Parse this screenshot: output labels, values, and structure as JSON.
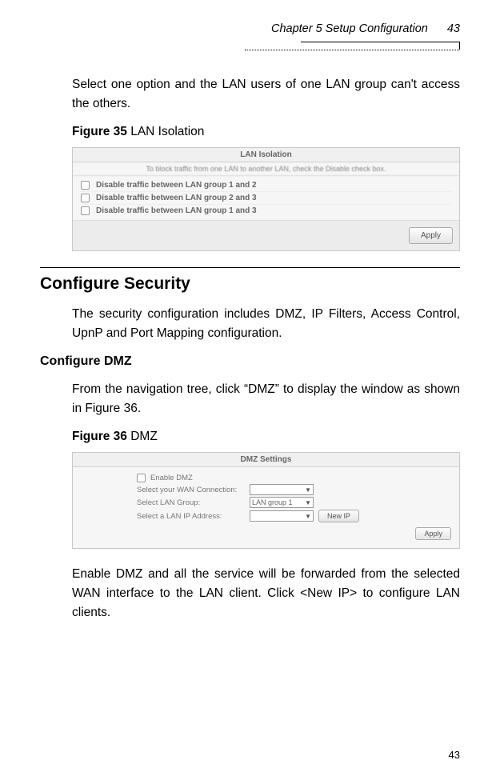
{
  "header": {
    "chapter": "Chapter 5 Setup Configuration",
    "page_top": "43"
  },
  "intro_paragraph": "Select one option and the LAN users of one LAN group can't access the others.",
  "figure35": {
    "caption_bold": "Figure 35",
    "caption_rest": " LAN Isolation",
    "panel_title": "LAN Isolation",
    "panel_subtitle": "To block traffic from one LAN to another LAN, check the Disable check box.",
    "rows": [
      "Disable traffic between LAN group 1 and 2",
      "Disable traffic between LAN group 2 and 3",
      "Disable traffic between LAN group 1 and 3"
    ],
    "apply_label": "Apply"
  },
  "section_heading": "Configure Security",
  "security_paragraph": "The security configuration includes DMZ, IP Filters, Access Control, UpnP and Port Mapping configuration.",
  "subsection_heading": "Configure DMZ",
  "dmz_paragraph1": "From the navigation tree, click “DMZ” to display the window as shown in Figure 36.",
  "figure36": {
    "caption_bold": "Figure 36",
    "caption_rest": " DMZ",
    "panel_title": "DMZ Settings",
    "enable_label": "Enable DMZ",
    "rows": [
      {
        "label": "Select your WAN Connection:",
        "value": ""
      },
      {
        "label": "Select LAN Group:",
        "value": "LAN group 1"
      },
      {
        "label": "Select a LAN IP Address:",
        "value": ""
      }
    ],
    "newip_label": "New IP",
    "apply_label": "Apply"
  },
  "dmz_paragraph2": "Enable DMZ and all the service will be forwarded from the selected WAN interface to the LAN client. Click <New IP> to configure LAN clients.",
  "footer_page": "43"
}
